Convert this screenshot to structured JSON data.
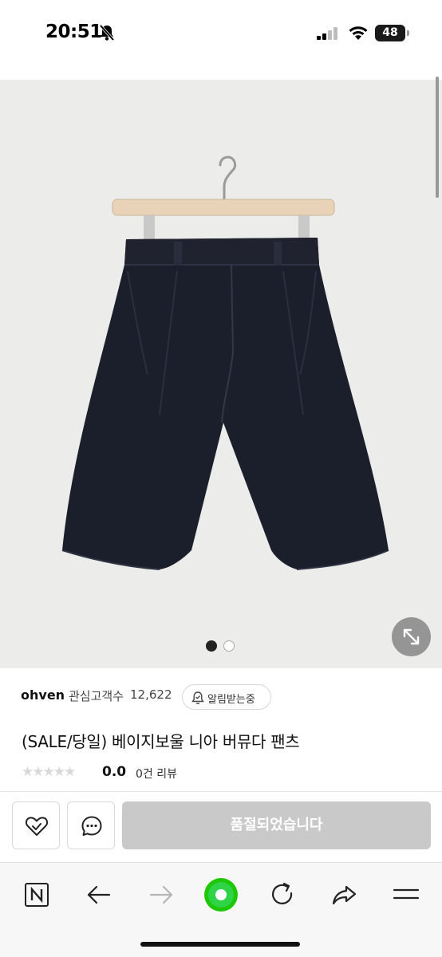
{
  "status_bar": {
    "time": "20:51",
    "battery": "48",
    "icons": [
      "bell-slash-icon",
      "cellular-signal-icon",
      "wifi-icon",
      "battery-icon"
    ]
  },
  "gallery": {
    "total_images": 2,
    "active_index": 0,
    "expand_icon": "expand-arrows-icon"
  },
  "store": {
    "name": "ohven",
    "follower_label": "관심고객수",
    "follower_count": "12,622",
    "alarm_label": "알림받는중",
    "alarm_icon": "bell-check-icon"
  },
  "product": {
    "title": "(SALE/당일) 베이지보울 니아 버뮤다 팬츠",
    "stars": "★★★★★",
    "rating": "0.0",
    "reviews": "0건 리뷰"
  },
  "actions": {
    "wishlist_icon": "heart-check-icon",
    "chat_icon": "chat-bubble-icon",
    "soldout_label": "품절되었습니다"
  },
  "browser_nav": {
    "items": [
      "naver-home-icon",
      "back-arrow-icon",
      "forward-arrow-icon",
      "green-dot-icon",
      "refresh-icon",
      "share-icon",
      "menu-icon"
    ]
  },
  "colors": {
    "soldout_bg": "#c9c9c9",
    "green_dot": "#1ec800",
    "shorts": "#1b1e2b",
    "hanger_wood": "#e8d3b8"
  }
}
